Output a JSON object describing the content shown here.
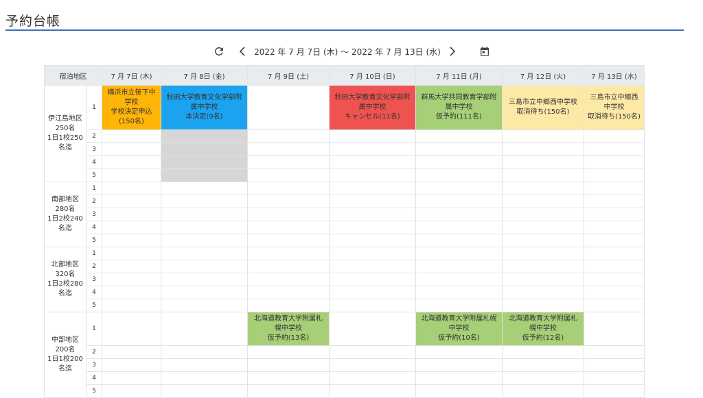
{
  "page": {
    "title": "予約台帳"
  },
  "nav": {
    "refresh_icon": "refresh-icon",
    "prev_icon": "chevron-left-icon",
    "next_icon": "chevron-right-icon",
    "calendar_icon": "calendar-icon",
    "range": "2022 年 7 月 7日 (木) 〜 2022 年 7 月 13日 (水)"
  },
  "table": {
    "header_region": "宿泊地区",
    "days": [
      "7 月 7日 (木)",
      "7 月 8日 (金)",
      "7 月 9日 (土)",
      "7 月 10日 (日)",
      "7 月 11日 (月)",
      "7 月 12日 (火)",
      "7 月 13日 (水)"
    ],
    "regions": [
      {
        "lines": [
          "伊江島地区",
          "250名",
          "1日1校250",
          "名迄"
        ],
        "lanes": [
          "1",
          "2",
          "3",
          "4",
          "5"
        ],
        "bookings": [
          {
            "line1": "横浜市立笹下中",
            "line2": "学校",
            "line3": "学校決定申込",
            "line4": "(150名)"
          },
          {
            "line1": "秋田大学教育文化学部附",
            "line2": "属中学校",
            "line3": "本決定(9名)"
          },
          {
            "line1": "秋田大学教育文化学部附",
            "line2": "属中学校",
            "line3": "キャンセル(11名)"
          },
          {
            "line1": "群馬大学共同教育学部附",
            "line2": "属中学校",
            "line3": "仮予約(111名)"
          },
          {
            "line1": "三島市立中郷西中学校",
            "line2": "取消待ち(150名)"
          },
          {
            "line1": "三島市立中郷西",
            "line2": "中学校",
            "line3": "取消待ち(150名)"
          }
        ]
      },
      {
        "lines": [
          "南部地区",
          "280名",
          "1日2校240",
          "名迄"
        ],
        "lanes": [
          "1",
          "2",
          "3",
          "4",
          "5"
        ]
      },
      {
        "lines": [
          "北部地区",
          "320名",
          "1日2校280",
          "名迄"
        ],
        "lanes": [
          "1",
          "2",
          "3",
          "4",
          "5"
        ]
      },
      {
        "lines": [
          "中部地区",
          "200名",
          "1日1校200",
          "名迄"
        ],
        "lanes": [
          "1",
          "2",
          "3",
          "4",
          "5"
        ],
        "bookings": [
          {
            "line1": "北海道教育大学附属札",
            "line2": "幌中学校",
            "line3": "仮予約(13名)"
          },
          {
            "line1": "北海道教育大学附属札幌",
            "line2": "中学校",
            "line3": "仮予約(10名)"
          },
          {
            "line1": "北海道教育大学附属札",
            "line2": "幌中学校",
            "line3": "仮予約(12名)"
          }
        ]
      }
    ]
  },
  "colors": {
    "accent": "#3b6fb6",
    "school_decision": "#ffb408",
    "confirmed": "#1ba3f0",
    "cancelled": "#ef5350",
    "provisional": "#a6cf77",
    "waitlist": "#fde9a6",
    "blocked": "#d6d6d6"
  }
}
